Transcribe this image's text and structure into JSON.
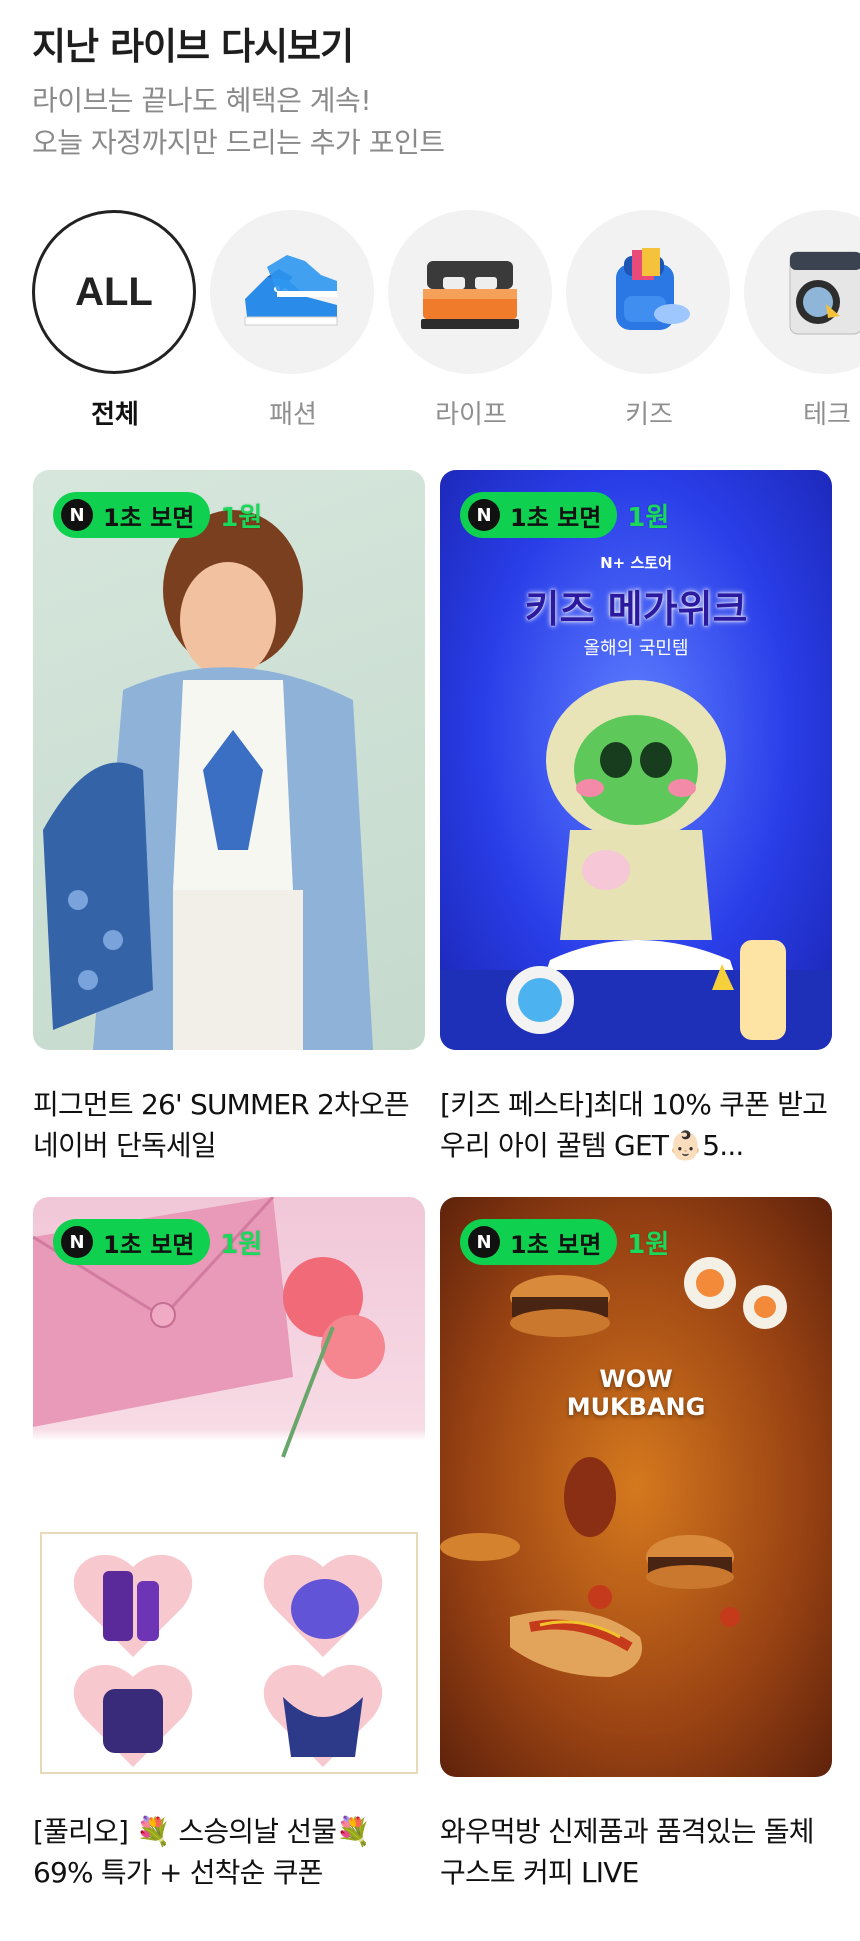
{
  "header": {
    "title": "지난 라이브 다시보기",
    "subtitle_line1": "라이브는 끝나도 혜택은 계속!",
    "subtitle_line2": "오늘 자정까지만 드리는 추가 포인트"
  },
  "categories": [
    {
      "label": "전체",
      "icon_text": "ALL",
      "icon": "all-text",
      "active": true
    },
    {
      "label": "패션",
      "icon": "sneakers-icon",
      "active": false
    },
    {
      "label": "라이프",
      "icon": "bed-icon",
      "active": false
    },
    {
      "label": "키즈",
      "icon": "backpack-icon",
      "active": false
    },
    {
      "label": "테크",
      "icon": "washing-machine-icon",
      "active": false
    }
  ],
  "badge": {
    "label": "1초 보면",
    "reward": "1원",
    "n_glyph": "N"
  },
  "cards": [
    {
      "title": "피그먼트 26' SUMMER 2차오픈 네이버 단독세일"
    },
    {
      "title": "[키즈 페스타]최대 10% 쿠폰 받고 우리 아이 꿀템 GET👶🏻5...",
      "banner_brand": "N+ 스토어",
      "banner_title": "키즈 메가위크",
      "banner_sub": "올해의 국민템"
    },
    {
      "title": "[풀리오] 💐 스승의날 선물💐 69% 특가 + 선착순 쿠폰"
    },
    {
      "title": "와우먹방 신제품과 품격있는 돌체구스토 커피 LIVE",
      "banner_logo_line1": "WOW",
      "banner_logo_line2": "MUKBANG"
    }
  ],
  "colors": {
    "badge_green": "#10d14f",
    "text_dark": "#111111",
    "text_gray": "#8a8a8a"
  }
}
